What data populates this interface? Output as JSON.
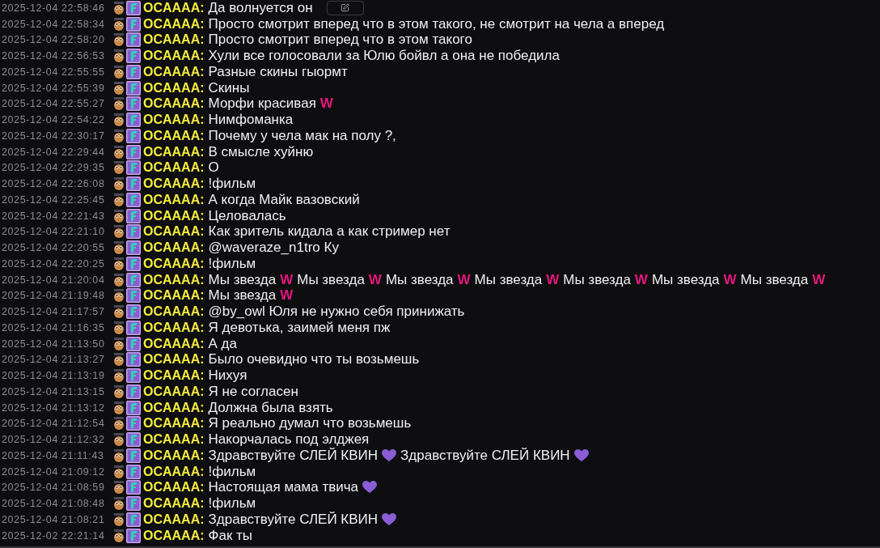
{
  "messages": [
    {
      "time": "2025-12-04 22:58:46",
      "user": "OCAAAA:",
      "hovered": true,
      "parts": [
        {
          "kind": "text",
          "text": "Да волнуется он"
        }
      ]
    },
    {
      "time": "2025-12-04 22:58:34",
      "user": "OCAAAA:",
      "hovered": false,
      "parts": [
        {
          "kind": "text",
          "text": "Просто смотрит вперед что в этом такого, не смотрит на чела а вперед"
        }
      ]
    },
    {
      "time": "2025-12-04 22:58:20",
      "user": "OCAAAA:",
      "hovered": false,
      "parts": [
        {
          "kind": "text",
          "text": "Просто смотрит вперед что в этом такого"
        }
      ]
    },
    {
      "time": "2025-12-04 22:56:53",
      "user": "OCAAAA:",
      "hovered": false,
      "parts": [
        {
          "kind": "text",
          "text": "Хули все голосовали за Юлю бойвл а она не победила"
        }
      ]
    },
    {
      "time": "2025-12-04 22:55:55",
      "user": "OCAAAA:",
      "hovered": false,
      "parts": [
        {
          "kind": "text",
          "text": "Разные скины гыормт"
        }
      ]
    },
    {
      "time": "2025-12-04 22:55:39",
      "user": "OCAAAA:",
      "hovered": false,
      "parts": [
        {
          "kind": "text",
          "text": "Скины"
        }
      ]
    },
    {
      "time": "2025-12-04 22:55:27",
      "user": "OCAAAA:",
      "hovered": false,
      "parts": [
        {
          "kind": "text",
          "text": "Морфи красивая"
        },
        {
          "kind": "emote",
          "text": "W"
        }
      ]
    },
    {
      "time": "2025-12-04 22:54:22",
      "user": "OCAAAA:",
      "hovered": false,
      "parts": [
        {
          "kind": "text",
          "text": "Нимфоманка"
        }
      ]
    },
    {
      "time": "2025-12-04 22:30:17",
      "user": "OCAAAA:",
      "hovered": false,
      "parts": [
        {
          "kind": "text",
          "text": "Почему у чела мак на полу ?,"
        }
      ]
    },
    {
      "time": "2025-12-04 22:29:44",
      "user": "OCAAAA:",
      "hovered": false,
      "parts": [
        {
          "kind": "text",
          "text": "В смысле хуйню"
        }
      ]
    },
    {
      "time": "2025-12-04 22:29:35",
      "user": "OCAAAA:",
      "hovered": false,
      "parts": [
        {
          "kind": "text",
          "text": "О"
        }
      ]
    },
    {
      "time": "2025-12-04 22:26:08",
      "user": "OCAAAA:",
      "hovered": false,
      "parts": [
        {
          "kind": "text",
          "text": "!фильм"
        }
      ]
    },
    {
      "time": "2025-12-04 22:25:45",
      "user": "OCAAAA:",
      "hovered": false,
      "parts": [
        {
          "kind": "text",
          "text": "А когда Майк вазовский"
        }
      ]
    },
    {
      "time": "2025-12-04 22:21:43",
      "user": "OCAAAA:",
      "hovered": false,
      "parts": [
        {
          "kind": "text",
          "text": "Целовалась"
        }
      ]
    },
    {
      "time": "2025-12-04 22:21:10",
      "user": "OCAAAA:",
      "hovered": false,
      "parts": [
        {
          "kind": "text",
          "text": "Как зритель кидала а как стример нет"
        }
      ]
    },
    {
      "time": "2025-12-04 22:20:55",
      "user": "OCAAAA:",
      "hovered": false,
      "parts": [
        {
          "kind": "text",
          "text": "@waveraze_n1tro Ку"
        }
      ]
    },
    {
      "time": "2025-12-04 22:20:25",
      "user": "OCAAAA:",
      "hovered": false,
      "parts": [
        {
          "kind": "text",
          "text": "!фильм"
        }
      ]
    },
    {
      "time": "2025-12-04 21:20:04",
      "user": "OCAAAA:",
      "hovered": false,
      "parts": [
        {
          "kind": "text",
          "text": "Мы звезда"
        },
        {
          "kind": "emote",
          "text": "W"
        },
        {
          "kind": "text",
          "text": "Мы звезда"
        },
        {
          "kind": "emote",
          "text": "W"
        },
        {
          "kind": "text",
          "text": "Мы звезда"
        },
        {
          "kind": "emote",
          "text": "W"
        },
        {
          "kind": "text",
          "text": "Мы звезда"
        },
        {
          "kind": "emote",
          "text": "W"
        },
        {
          "kind": "text",
          "text": "Мы звезда"
        },
        {
          "kind": "emote",
          "text": "W"
        },
        {
          "kind": "text",
          "text": "Мы звезда"
        },
        {
          "kind": "emote",
          "text": "W"
        },
        {
          "kind": "text",
          "text": "Мы звезда"
        },
        {
          "kind": "emote",
          "text": "W"
        }
      ]
    },
    {
      "time": "2025-12-04 21:19:48",
      "user": "OCAAAA:",
      "hovered": false,
      "parts": [
        {
          "kind": "text",
          "text": "Мы звезда"
        },
        {
          "kind": "emote",
          "text": "W"
        }
      ]
    },
    {
      "time": "2025-12-04 21:17:57",
      "user": "OCAAAA:",
      "hovered": false,
      "parts": [
        {
          "kind": "text",
          "text": "@by_owl Юля не нужно себя принижать"
        }
      ]
    },
    {
      "time": "2025-12-04 21:16:35",
      "user": "OCAAAA:",
      "hovered": false,
      "parts": [
        {
          "kind": "text",
          "text": "Я девотька, заимей меня пж"
        }
      ]
    },
    {
      "time": "2025-12-04 21:13:50",
      "user": "OCAAAA:",
      "hovered": false,
      "parts": [
        {
          "kind": "text",
          "text": "А да"
        }
      ]
    },
    {
      "time": "2025-12-04 21:13:27",
      "user": "OCAAAA:",
      "hovered": false,
      "parts": [
        {
          "kind": "text",
          "text": "Было очевидно что ты возьмешь"
        }
      ]
    },
    {
      "time": "2025-12-04 21:13:19",
      "user": "OCAAAA:",
      "hovered": false,
      "parts": [
        {
          "kind": "text",
          "text": "Нихуя"
        }
      ]
    },
    {
      "time": "2025-12-04 21:13:15",
      "user": "OCAAAA:",
      "hovered": false,
      "parts": [
        {
          "kind": "text",
          "text": "Я не согласен"
        }
      ]
    },
    {
      "time": "2025-12-04 21:13:12",
      "user": "OCAAAA:",
      "hovered": false,
      "parts": [
        {
          "kind": "text",
          "text": "Должна была взять"
        }
      ]
    },
    {
      "time": "2025-12-04 21:12:54",
      "user": "OCAAAA:",
      "hovered": false,
      "parts": [
        {
          "kind": "text",
          "text": "Я реально думал что возьмешь"
        }
      ]
    },
    {
      "time": "2025-12-04 21:12:32",
      "user": "OCAAAA:",
      "hovered": false,
      "parts": [
        {
          "kind": "text",
          "text": "Накорчалась под элджея"
        }
      ]
    },
    {
      "time": "2025-12-04 21:11:43",
      "user": "OCAAAA:",
      "hovered": false,
      "parts": [
        {
          "kind": "text",
          "text": "Здравствуйте СЛЕЙ КВИН"
        },
        {
          "kind": "heart"
        },
        {
          "kind": "text",
          "text": "Здравствуйте СЛЕЙ КВИН"
        },
        {
          "kind": "heart"
        }
      ]
    },
    {
      "time": "2025-12-04 21:09:12",
      "user": "OCAAAA:",
      "hovered": false,
      "parts": [
        {
          "kind": "text",
          "text": "!фильм"
        }
      ]
    },
    {
      "time": "2025-12-04 21:08:59",
      "user": "OCAAAA:",
      "hovered": false,
      "parts": [
        {
          "kind": "text",
          "text": "Настоящая мама твича"
        },
        {
          "kind": "heart"
        }
      ]
    },
    {
      "time": "2025-12-04 21:08:48",
      "user": "OCAAAA:",
      "hovered": false,
      "parts": [
        {
          "kind": "text",
          "text": "!фильм"
        }
      ]
    },
    {
      "time": "2025-12-04 21:08:21",
      "user": "OCAAAA:",
      "hovered": false,
      "parts": [
        {
          "kind": "text",
          "text": "Здравствуйте СЛЕЙ КВИН"
        },
        {
          "kind": "heart"
        }
      ]
    },
    {
      "time": "2025-12-02 22:21:14",
      "user": "OCAAAA:",
      "hovered": false,
      "parts": [
        {
          "kind": "text",
          "text": "Фак ты"
        }
      ]
    }
  ]
}
